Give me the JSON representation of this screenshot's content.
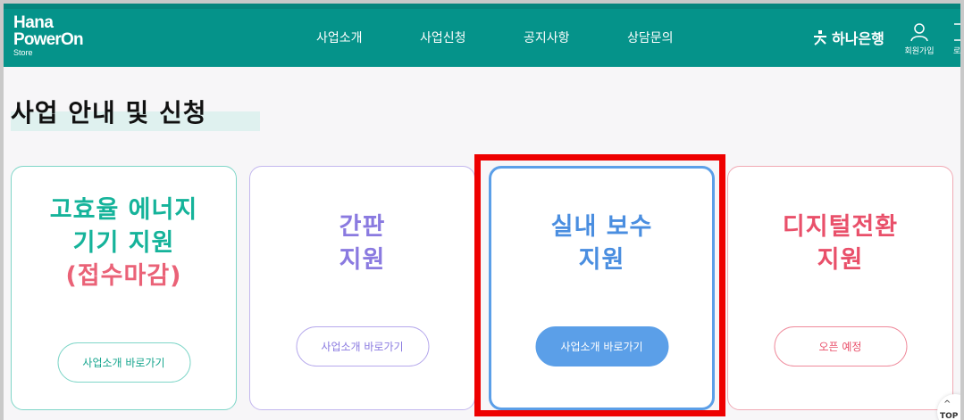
{
  "header": {
    "logo": {
      "line1": "Hana",
      "line2": "PowerOn",
      "line3": "Store"
    },
    "nav": [
      {
        "label": "사업소개"
      },
      {
        "label": "사업신청"
      },
      {
        "label": "공지사항"
      },
      {
        "label": "상담문의"
      }
    ],
    "bank_label": "하나은행",
    "member_label": "회원가입",
    "edge_label": "로"
  },
  "page_title": "사업 안내 및 신청",
  "cards": [
    {
      "line1": "고효율 에너지",
      "line2": "기기 지원",
      "line3": "(접수마감)",
      "button": "사업소개 바로가기"
    },
    {
      "line1": "간판",
      "line2": "지원",
      "button": "사업소개 바로가기"
    },
    {
      "line1": "실내 보수",
      "line2": "지원",
      "button": "사업소개 바로가기"
    },
    {
      "line1": "디지털전환",
      "line2": "지원",
      "button": "오픈 예정"
    }
  ],
  "top_button": "TOP",
  "colors": {
    "header": "#05938a",
    "highlight": "#ee0000"
  }
}
